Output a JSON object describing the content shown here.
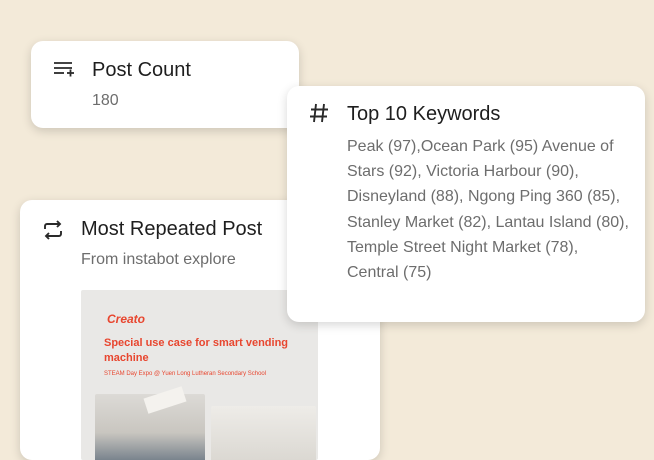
{
  "post_count": {
    "title": "Post Count",
    "value": "180",
    "icon": "list-add-icon"
  },
  "keywords": {
    "title": "Top 10 Keywords",
    "text": "Peak (97),Ocean Park (95) Avenue of Stars (92), Victoria Harbour (90), Disneyland (88), Ngong Ping 360 (85), Stanley Market (82), Lantau Island (80), Temple Street Night Market (78), Central (75)",
    "icon": "hash-icon"
  },
  "most_repeated": {
    "title": "Most Repeated Post",
    "subtitle": "From instabot explore",
    "icon": "repeat-icon",
    "thumbnail": {
      "brand": "Creato",
      "headline": "Special use case for smart vending machine",
      "caption": "STEAM Day Expo @ Yuen Long Lutheran Secondary School"
    }
  },
  "colors": {
    "background": "#f3ead9",
    "accent": "#e8462f"
  }
}
